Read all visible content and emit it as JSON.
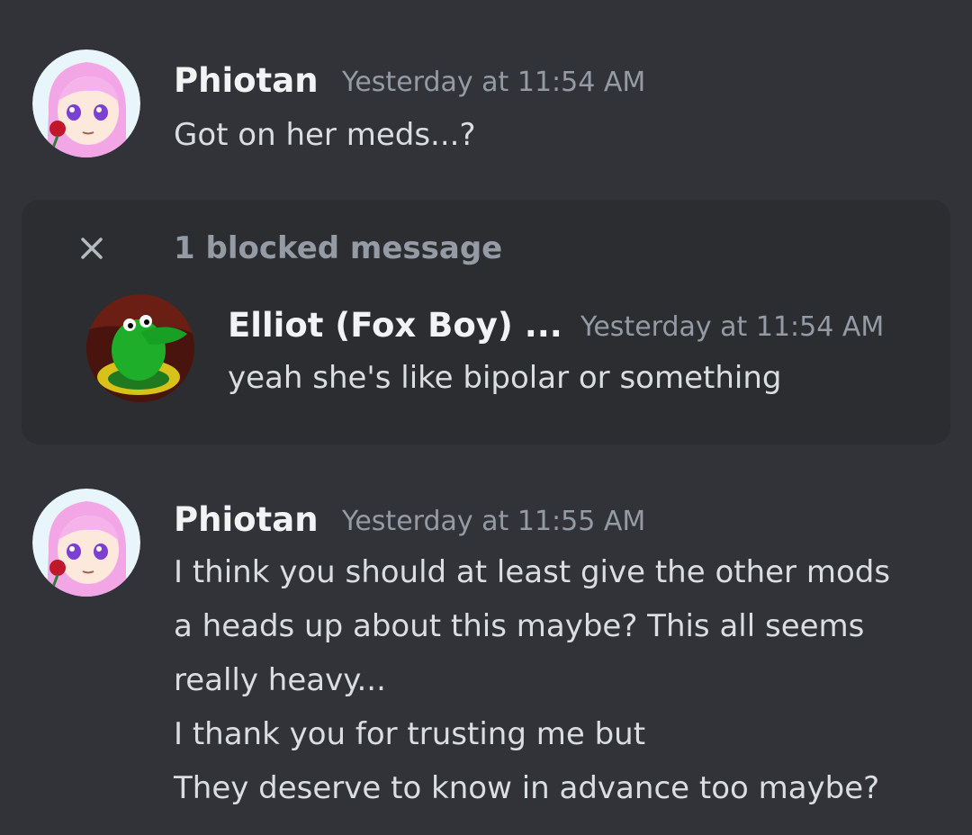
{
  "messages": [
    {
      "author": "Phiotan",
      "timestamp": "Yesterday at 11:54 AM",
      "lines": [
        "Got on her meds...?"
      ]
    },
    {
      "author": "Phiotan",
      "timestamp": "Yesterday at 11:55 AM",
      "lines": [
        "I think you should at least give the other mods",
        "a heads up about this maybe? This all seems",
        "really heavy...",
        "I thank you for trusting me but",
        "They deserve to know in advance too maybe?"
      ]
    }
  ],
  "blocked": {
    "label": "1 blocked message",
    "close_icon": "close-icon",
    "message": {
      "author": "Elliot (Fox Boy) ...",
      "timestamp": "Yesterday at 11:54 AM",
      "text": "yeah she's like bipolar or something"
    }
  },
  "colors": {
    "background": "#313338",
    "blocked_background": "#2b2d31",
    "username": "#f2f3f5",
    "timestamp": "#949ba4",
    "text": "#dbdee1"
  }
}
